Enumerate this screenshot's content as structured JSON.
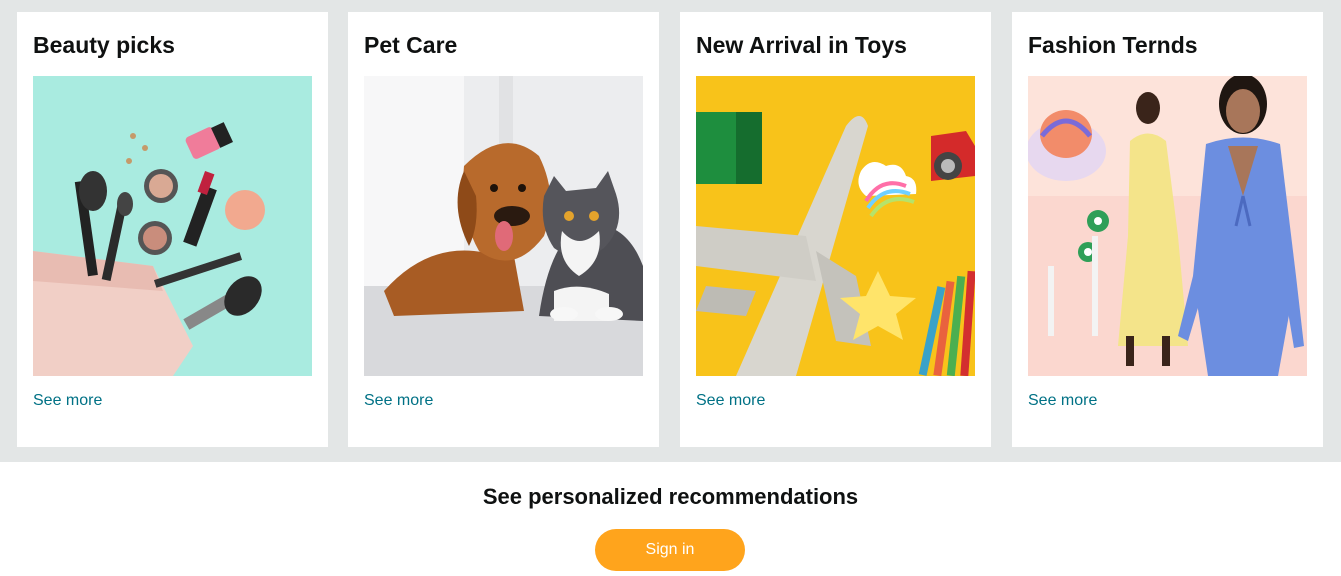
{
  "cards": [
    {
      "title": "Beauty picks",
      "link": "See more",
      "image": "makeup-products-image"
    },
    {
      "title": "Pet Care",
      "link": "See more",
      "image": "dog-and-cat-image"
    },
    {
      "title": "New Arrival in Toys",
      "link": "See more",
      "image": "toy-airplane-image"
    },
    {
      "title": "Fashion Ternds",
      "link": "See more",
      "image": "fashion-models-image"
    }
  ],
  "signin": {
    "heading": "See personalized recommendations",
    "button_label": "Sign in"
  },
  "colors": {
    "band_background": "#e3e6e6",
    "link": "#007185",
    "signin_button": "#ffa41c"
  }
}
